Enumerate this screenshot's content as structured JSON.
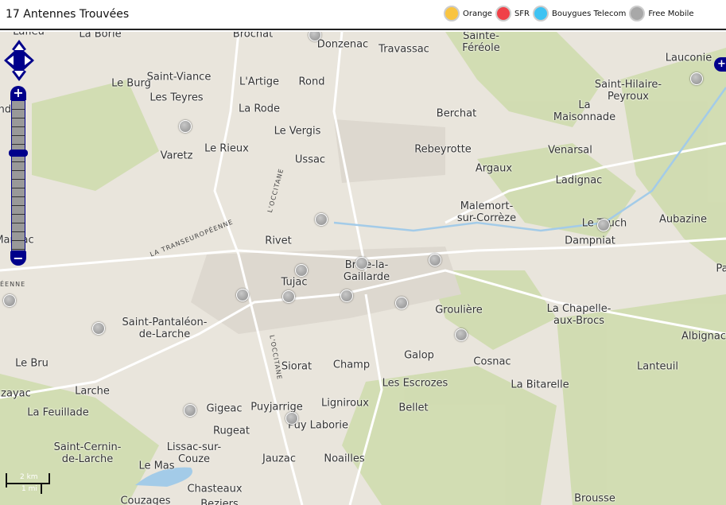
{
  "header": {
    "title": "17 Antennes Trouvées"
  },
  "legend": [
    {
      "label": "Orange",
      "color": "#f9c440"
    },
    {
      "label": "SFR",
      "color": "#f04148"
    },
    {
      "label": "Bouygues Telecom",
      "color": "#3ec3f3"
    },
    {
      "label": "Free Mobile",
      "color": "#a8a8a8"
    }
  ],
  "map": {
    "places": [
      "Lafleu",
      "La Borie",
      "Brochat",
      "Donzenac",
      "Travassac",
      "Sainte-\nFéréole",
      "Lauconie",
      "Le Burg",
      "Saint-Viance",
      "L'Artige",
      "Rond",
      "Les Teyres",
      "La Rode",
      "Saint-Hilaire-\nPeyroux",
      "Berchat",
      "La\nMaisonnade",
      "ndon",
      "Le Vergis",
      "Varetz",
      "Le Rieux",
      "Rebeyrotte",
      "Venarsal",
      "Ussac",
      "Argaux",
      "Ladignac",
      "Malemort-\nsur-Corrèze",
      "Aubazine",
      "Le Teuch",
      "Dampniat",
      "Mansac",
      "Rivet",
      "Brive-la-\nGaillarde",
      "Tujac",
      "Pa",
      "Groulière",
      "La Chapelle-\naux-Brocs",
      "Saint-Pantaléon-\nde-Larche",
      "Albignac",
      "Galop",
      "Cosnac",
      "Le Bru",
      "Siorat",
      "Champ",
      "Lanteuil",
      "azayac",
      "Les Escrozes",
      "La Bitarelle",
      "Larche",
      "Ligniroux",
      "La Feuillade",
      "Gigeac",
      "Puyjarrige",
      "Bellet",
      "Rugeat",
      "Puy Laborie",
      "Saint-Cernin-\nde-Larche",
      "Lissac-sur-\nCouze",
      "Le Mas",
      "Jauzac",
      "Noailles",
      "Chasteaux",
      "Couzages",
      "Beziers",
      "Brousse"
    ],
    "roads": [
      "L'OCCITANE",
      "LA TRANSEUROPÉENNE",
      "L'OCCITANE",
      "ÉENNE"
    ],
    "antenna_count": 17,
    "scale": {
      "metric": "2 km",
      "imperial": "1 mi"
    }
  }
}
